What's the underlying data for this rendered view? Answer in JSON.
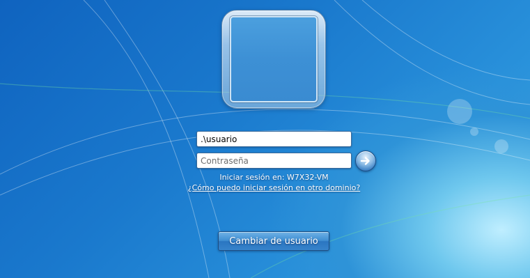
{
  "login": {
    "username_value": ".\\usuario",
    "password_placeholder": "Contraseña",
    "go_icon": "arrow-right-icon",
    "signin_to": "Iniciar sesión en: W7X32-VM",
    "other_domain_link": "¿Cómo puedo iniciar sesión en otro dominio?",
    "switch_user_label": "Cambiar de usuario"
  },
  "colors": {
    "background": "#1a79cd",
    "text": "#ffffff",
    "field_bg": "#ffffff"
  }
}
